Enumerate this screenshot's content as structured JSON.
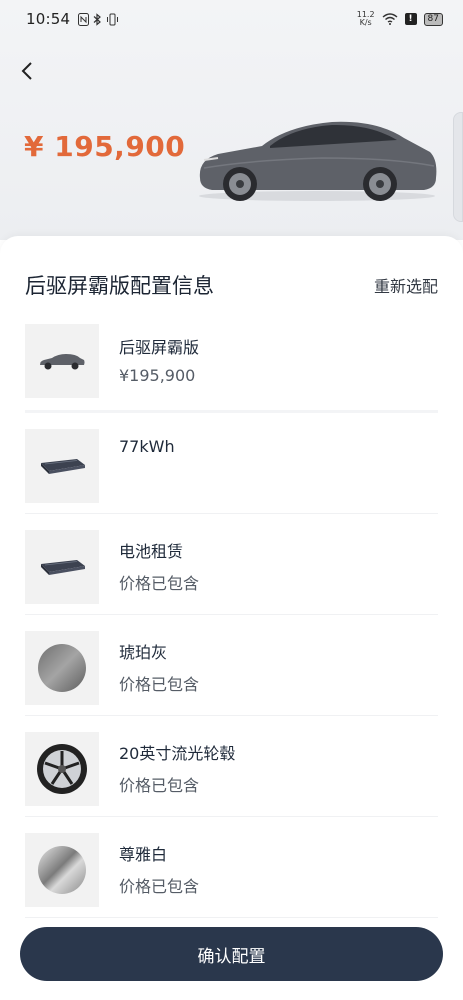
{
  "status_bar": {
    "time": "10:54",
    "net_speed_value": "11.2",
    "net_speed_unit": "K/s",
    "battery": "87"
  },
  "header": {
    "price": "¥ 195,900"
  },
  "sheet": {
    "title": "后驱屏霸版配置信息",
    "reselect_label": "重新选配"
  },
  "items": [
    {
      "name": "后驱屏霸版",
      "sub": "¥195,900",
      "thumb": "car-thumb-icon"
    },
    {
      "name": "77kWh",
      "sub": "",
      "thumb": "battery-pack-icon"
    },
    {
      "name": "电池租赁",
      "sub": "价格已包含",
      "thumb": "battery-pack-icon"
    },
    {
      "name": "琥珀灰",
      "sub": "价格已包含",
      "thumb": "color-swatch-icon"
    },
    {
      "name": "20英寸流光轮毂",
      "sub": "价格已包含",
      "thumb": "wheel-icon"
    },
    {
      "name": "尊雅白",
      "sub": "价格已包含",
      "thumb": "interior-swatch-icon"
    }
  ],
  "confirm_label": "确认配置",
  "colors": {
    "accent_price": "#e2693a",
    "button_bg": "#2a374c"
  }
}
